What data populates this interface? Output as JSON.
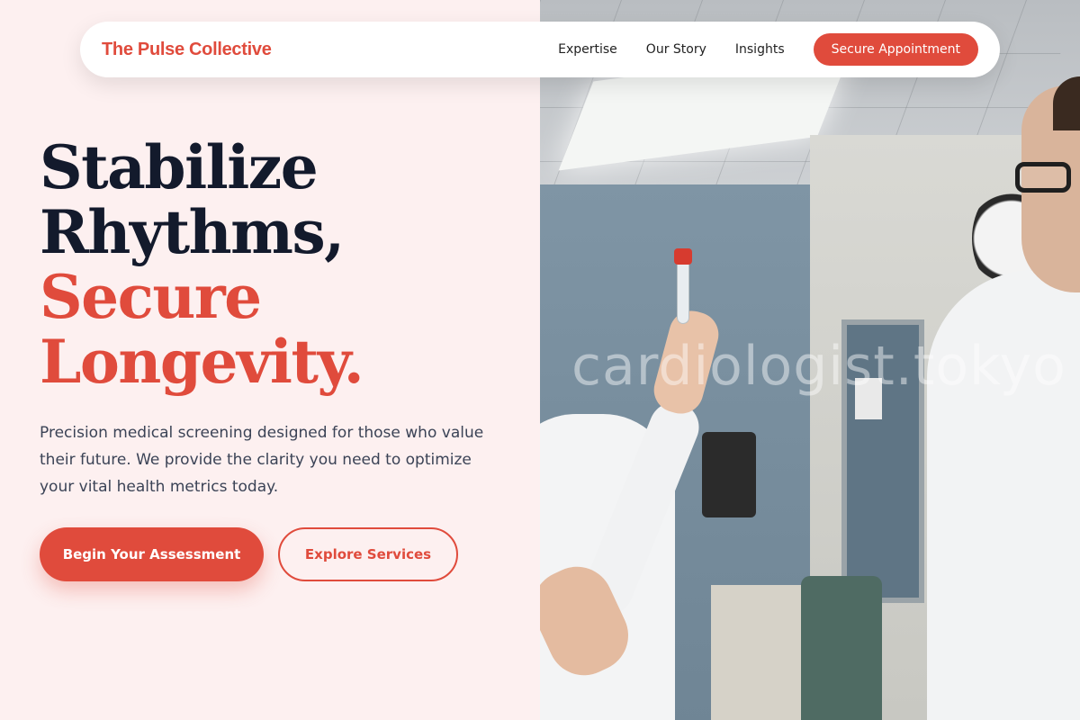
{
  "nav": {
    "brand": "The Pulse Collective",
    "links": [
      "Expertise",
      "Our Story",
      "Insights"
    ],
    "cta_label": "Secure Appointment"
  },
  "hero": {
    "title_dark": [
      "Stabilize",
      "Rhythms,"
    ],
    "title_accent": [
      "Secure",
      "Longevity."
    ],
    "description": "Precision medical screening designed for those who value their future. We provide the clarity you need to optimize your vital health metrics today.",
    "primary_button": "Begin Your Assessment",
    "secondary_button": "Explore Services"
  },
  "photo": {
    "watermark": "cardiologist.tokyo"
  },
  "colors": {
    "accent": "#e04b3c",
    "background": "#fdf0f0",
    "heading": "#131a2c",
    "body_text": "#3b4356"
  }
}
